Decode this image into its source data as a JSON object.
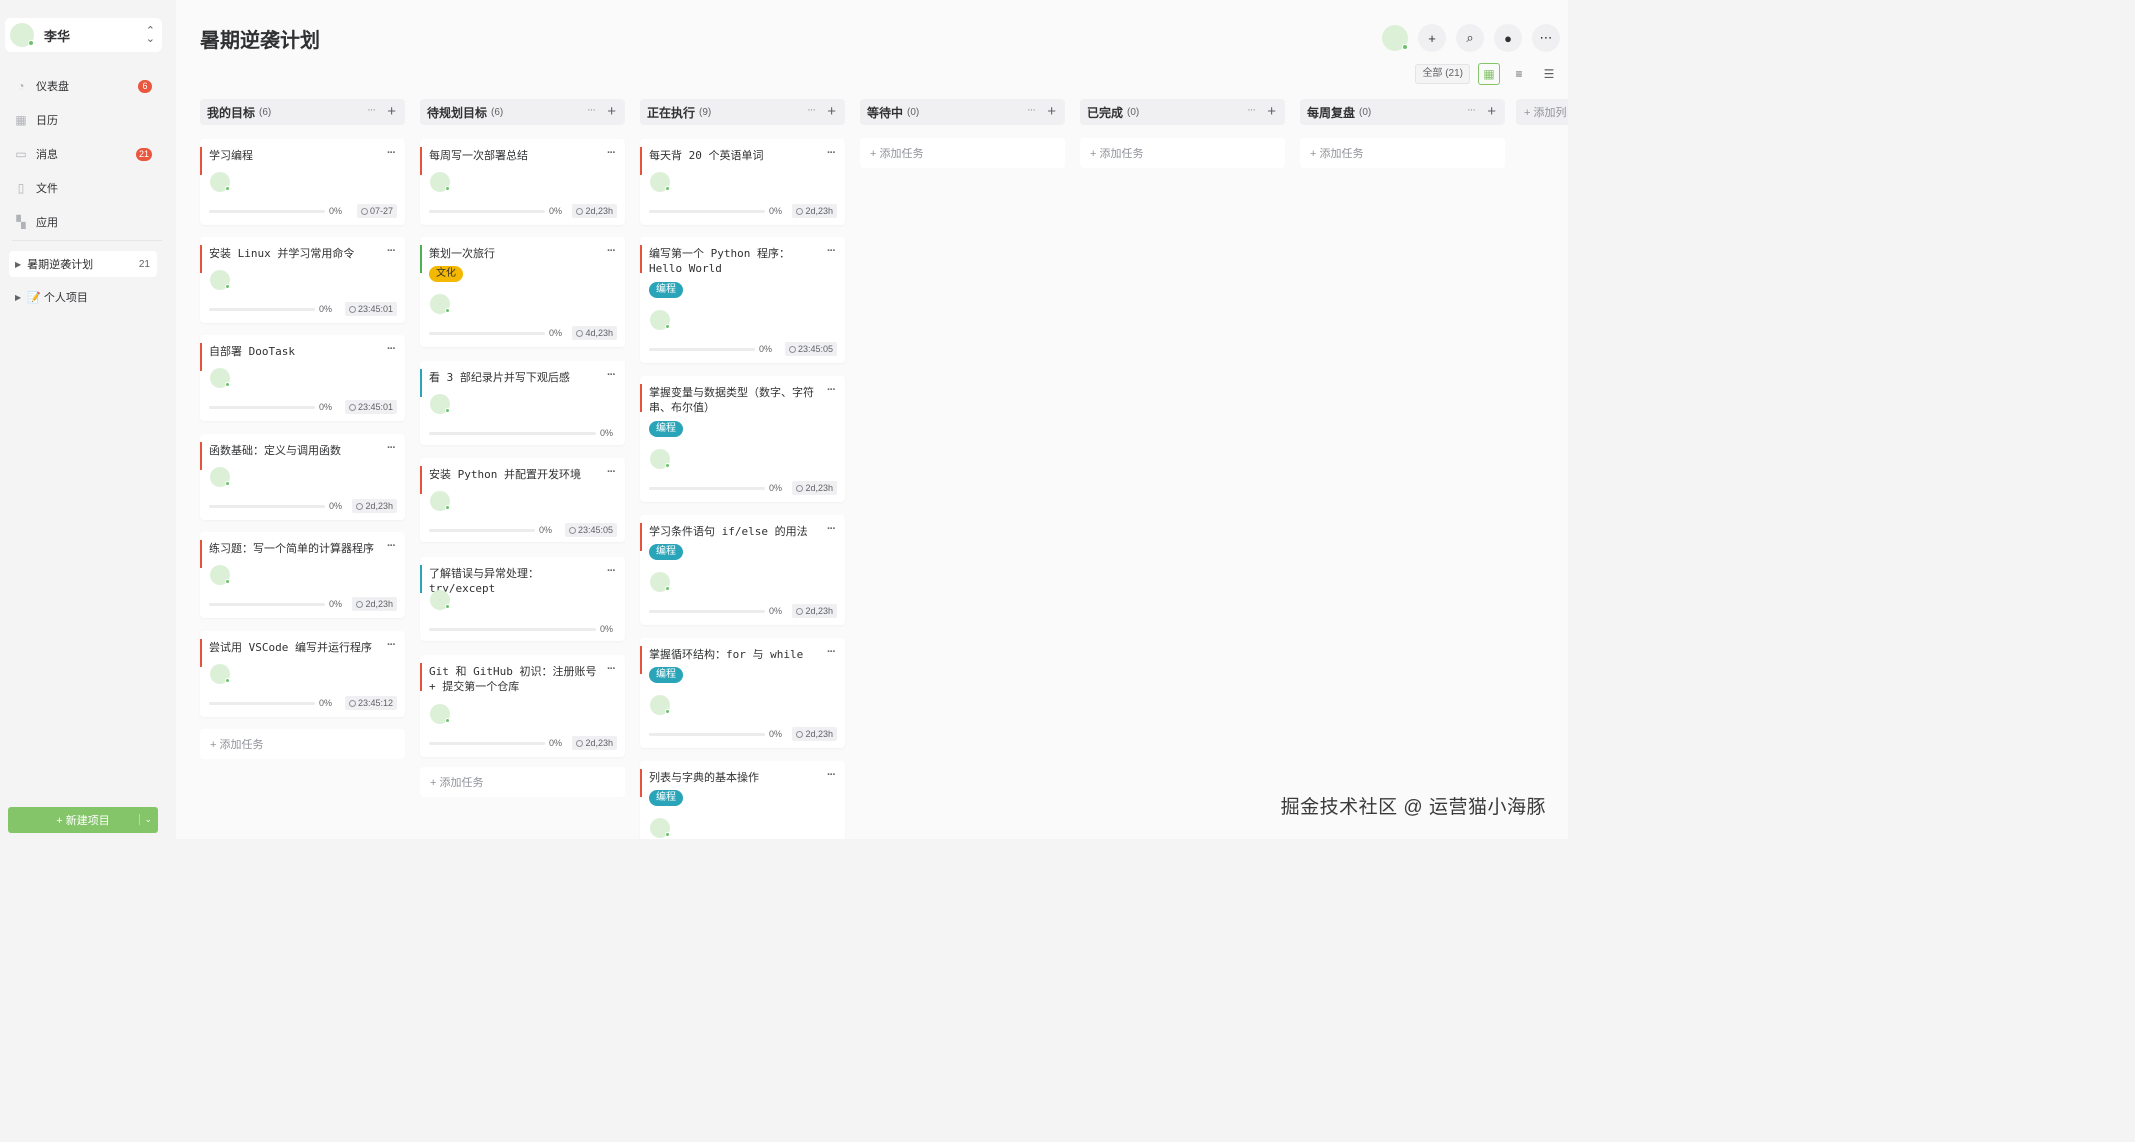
{
  "user": {
    "name": "李华"
  },
  "nav": [
    {
      "label": "仪表盘",
      "badge": "6",
      "icon": "dashboard-icon"
    },
    {
      "label": "日历",
      "badge": "",
      "icon": "calendar-icon"
    },
    {
      "label": "消息",
      "badge": "21",
      "icon": "message-icon"
    },
    {
      "label": "文件",
      "badge": "",
      "icon": "file-icon"
    },
    {
      "label": "应用",
      "badge": "",
      "icon": "apps-icon"
    }
  ],
  "projects": [
    {
      "label": "暑期逆袭计划",
      "count": "21",
      "active": true
    },
    {
      "label": "📝 个人项目",
      "count": "",
      "active": false
    }
  ],
  "new_project_label": "+ 新建项目",
  "page_title": "暑期逆袭计划",
  "filter": {
    "all_label": "全部 (21)"
  },
  "columns": [
    {
      "title": "我的目标",
      "count": "(6)",
      "add_label": "+ 添加任务",
      "cards": [
        {
          "title": "学习编程",
          "tag": "",
          "progress": "0%",
          "time": "07-27",
          "color": "#e5533d"
        },
        {
          "title": "安装 Linux 并学习常用命令",
          "tag": "",
          "progress": "0%",
          "time": "23:45:01",
          "color": "#e5533d"
        },
        {
          "title": "自部署 DooTask",
          "tag": "",
          "progress": "0%",
          "time": "23:45:01",
          "color": "#e5533d"
        },
        {
          "title": "函数基础：定义与调用函数",
          "tag": "",
          "progress": "0%",
          "time": "2d,23h",
          "color": "#e5533d"
        },
        {
          "title": "练习题：写一个简单的计算器程序",
          "tag": "",
          "progress": "0%",
          "time": "2d,23h",
          "color": "#e5533d"
        },
        {
          "title": "尝试用 VSCode 编写并运行程序",
          "tag": "",
          "progress": "0%",
          "time": "23:45:12",
          "color": "#e5533d"
        }
      ]
    },
    {
      "title": "待规划目标",
      "count": "(6)",
      "add_label": "+ 添加任务",
      "cards": [
        {
          "title": "每周写一次部署总结",
          "tag": "",
          "progress": "0%",
          "time": "2d,23h",
          "color": "#e5533d"
        },
        {
          "title": "策划一次旅行",
          "tag": "文化",
          "tagColor": "#f5b800",
          "tagText": "#303133",
          "progress": "0%",
          "time": "4d,23h",
          "color": "#4caf50"
        },
        {
          "title": "看 3 部纪录片并写下观后感",
          "tag": "",
          "progress": "0%",
          "time": "",
          "color": "#2aa4b8"
        },
        {
          "title": "安装 Python 并配置开发环境",
          "tag": "",
          "progress": "0%",
          "time": "23:45:05",
          "color": "#e5533d"
        },
        {
          "title": "了解错误与异常处理：try/except",
          "tag": "",
          "progress": "0%",
          "time": "",
          "color": "#2aa4b8"
        },
        {
          "title": "Git 和 GitHub 初识：注册账号 + 提交第一个仓库",
          "tag": "",
          "progress": "0%",
          "time": "2d,23h",
          "color": "#e5533d"
        }
      ]
    },
    {
      "title": "正在执行",
      "count": "(9)",
      "add_label": "",
      "cards": [
        {
          "title": "每天背 20 个英语单词",
          "tag": "",
          "progress": "0%",
          "time": "2d,23h",
          "color": "#e5533d"
        },
        {
          "title": "编写第一个 Python 程序：Hello World",
          "tag": "编程",
          "tagColor": "#2aa4b8",
          "tagText": "#ffffff",
          "progress": "0%",
          "time": "23:45:05",
          "color": "#e5533d"
        },
        {
          "title": "掌握变量与数据类型（数字、字符串、布尔值）",
          "tag": "编程",
          "tagColor": "#2aa4b8",
          "tagText": "#ffffff",
          "progress": "0%",
          "time": "2d,23h",
          "color": "#e5533d"
        },
        {
          "title": "学习条件语句 if/else 的用法",
          "tag": "编程",
          "tagColor": "#2aa4b8",
          "tagText": "#ffffff",
          "progress": "0%",
          "time": "2d,23h",
          "color": "#e5533d"
        },
        {
          "title": "掌握循环结构：for 与 while",
          "tag": "编程",
          "tagColor": "#2aa4b8",
          "tagText": "#ffffff",
          "progress": "0%",
          "time": "2d,23h",
          "color": "#e5533d"
        },
        {
          "title": "列表与字典的基本操作",
          "tag": "编程",
          "tagColor": "#2aa4b8",
          "tagText": "#ffffff",
          "progress": "",
          "time": "",
          "color": "#e5533d"
        }
      ]
    },
    {
      "title": "等待中",
      "count": "(0)",
      "add_label": "+ 添加任务",
      "cards": []
    },
    {
      "title": "已完成",
      "count": "(0)",
      "add_label": "+ 添加任务",
      "cards": []
    },
    {
      "title": "每周复盘",
      "count": "(0)",
      "add_label": "+ 添加任务",
      "cards": []
    }
  ],
  "add_column_label": "+ 添加列",
  "watermark": "掘金技术社区 @ 运营猫小海豚"
}
